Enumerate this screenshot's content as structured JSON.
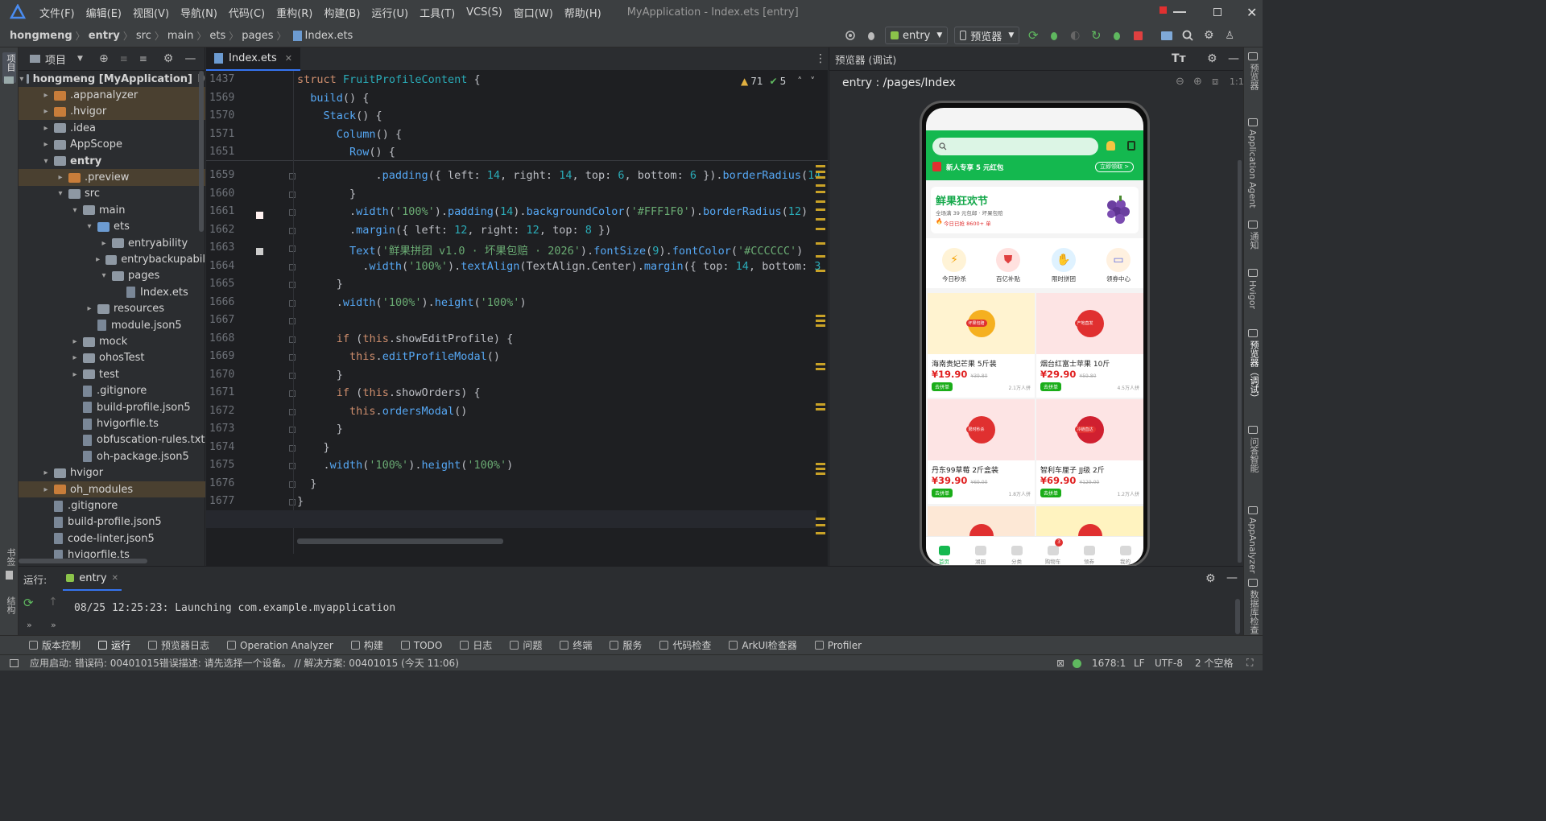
{
  "menu": {
    "items": [
      "文件(F)",
      "编辑(E)",
      "视图(V)",
      "导航(N)",
      "代码(C)",
      "重构(R)",
      "构建(B)",
      "运行(U)",
      "工具(T)",
      "VCS(S)",
      "窗口(W)",
      "帮助(H)"
    ],
    "window_title": "MyApplication - Index.ets [entry]"
  },
  "breadcrumb": {
    "items": [
      "hongmeng",
      "entry",
      "src",
      "main",
      "ets",
      "pages"
    ],
    "file": "Index.ets"
  },
  "toolbar": {
    "config": "entry",
    "previewer": "预览器"
  },
  "project": {
    "title": "项目",
    "rows": [
      {
        "label": "hongmeng [MyApplication]",
        "suffix": "D",
        "depth": 0,
        "type": "folder-g",
        "arrow": "▾",
        "bold": true
      },
      {
        "label": ".appanalyzer",
        "depth": 1,
        "type": "folder-o",
        "arrow": "▸",
        "hl": true
      },
      {
        "label": ".hvigor",
        "depth": 1,
        "type": "folder-o",
        "arrow": "▸",
        "hl": true
      },
      {
        "label": ".idea",
        "depth": 1,
        "type": "folder-g",
        "arrow": "▸"
      },
      {
        "label": "AppScope",
        "depth": 1,
        "type": "folder-g",
        "arrow": "▸"
      },
      {
        "label": "entry",
        "depth": 1,
        "type": "folder-g",
        "arrow": "▾",
        "bold": true
      },
      {
        "label": ".preview",
        "depth": 2,
        "type": "folder-o",
        "arrow": "▸",
        "hl": true
      },
      {
        "label": "src",
        "depth": 2,
        "type": "folder-g",
        "arrow": "▾"
      },
      {
        "label": "main",
        "depth": 3,
        "type": "folder-g",
        "arrow": "▾"
      },
      {
        "label": "ets",
        "depth": 4,
        "type": "folder-b",
        "arrow": "▾"
      },
      {
        "label": "entryability",
        "depth": 5,
        "type": "folder-g",
        "arrow": "▸"
      },
      {
        "label": "entrybackupabil",
        "depth": 5,
        "type": "folder-g",
        "arrow": "▸"
      },
      {
        "label": "pages",
        "depth": 5,
        "type": "folder-g",
        "arrow": "▾"
      },
      {
        "label": "Index.ets",
        "depth": 6,
        "type": "file",
        "arrow": ""
      },
      {
        "label": "resources",
        "depth": 4,
        "type": "folder-g",
        "arrow": "▸"
      },
      {
        "label": "module.json5",
        "depth": 4,
        "type": "file",
        "arrow": ""
      },
      {
        "label": "mock",
        "depth": 3,
        "type": "folder-g",
        "arrow": "▸"
      },
      {
        "label": "ohosTest",
        "depth": 3,
        "type": "folder-g",
        "arrow": "▸"
      },
      {
        "label": "test",
        "depth": 3,
        "type": "folder-g",
        "arrow": "▸"
      },
      {
        "label": ".gitignore",
        "depth": 3,
        "type": "file",
        "arrow": ""
      },
      {
        "label": "build-profile.json5",
        "depth": 3,
        "type": "file",
        "arrow": ""
      },
      {
        "label": "hvigorfile.ts",
        "depth": 3,
        "type": "file",
        "arrow": ""
      },
      {
        "label": "obfuscation-rules.txt",
        "depth": 3,
        "type": "file",
        "arrow": ""
      },
      {
        "label": "oh-package.json5",
        "depth": 3,
        "type": "file",
        "arrow": ""
      },
      {
        "label": "hvigor",
        "depth": 1,
        "type": "folder-g",
        "arrow": "▸"
      },
      {
        "label": "oh_modules",
        "depth": 1,
        "type": "folder-o",
        "arrow": "▸",
        "hl": true
      },
      {
        "label": ".gitignore",
        "depth": 1,
        "type": "file",
        "arrow": ""
      },
      {
        "label": "build-profile.json5",
        "depth": 1,
        "type": "file",
        "arrow": ""
      },
      {
        "label": "code-linter.json5",
        "depth": 1,
        "type": "file",
        "arrow": ""
      },
      {
        "label": "hvigorfile.ts",
        "depth": 1,
        "type": "file",
        "arrow": ""
      }
    ]
  },
  "editor": {
    "tab": "Index.ets",
    "warnings": "71",
    "ok": "5",
    "sticky": [
      {
        "n": "1437",
        "html": "<span class='kw'>struct</span> <span class='ty'>FruitProfileContent</span> {"
      },
      {
        "n": "1569",
        "html": "  <span class='fn'>build</span>() {"
      },
      {
        "n": "1570",
        "html": "    <span class='fn'>Stack</span>() {"
      },
      {
        "n": "1571",
        "html": "      <span class='fn'>Column</span>() {"
      },
      {
        "n": "1651",
        "html": "        <span class='fn'>Row</span>() {"
      }
    ],
    "lines": [
      {
        "n": "1659",
        "html": "            .<span class='fn'>padding</span>({ <span class='pm'>left</span>: <span class='nm'>14</span>, <span class='pm'>right</span>: <span class='nm'>14</span>, <span class='pm'>top</span>: <span class='nm'>6</span>, <span class='pm'>bottom</span>: <span class='nm'>6</span> }).<span class='fn'>borderRadius</span>(<span class='nm'>14</span>"
      },
      {
        "n": "1660",
        "html": "        }"
      },
      {
        "n": "1661",
        "html": "        .<span class='fn'>width</span>(<span class='st'>'100%'</span>).<span class='fn'>padding</span>(<span class='nm'>14</span>).<span class='fn'>backgroundColor</span>(<span class='st'>'#FFF1F0'</span>).<span class='fn'>borderRadius</span>(<span class='nm'>12</span>)"
      },
      {
        "n": "1662",
        "html": "        .<span class='fn'>margin</span>({ <span class='pm'>left</span>: <span class='nm'>12</span>, <span class='pm'>right</span>: <span class='nm'>12</span>, <span class='pm'>top</span>: <span class='nm'>8</span> })"
      },
      {
        "n": "1663",
        "html": "        <span class='fn'>Text</span>(<span class='st'>'鲜果拼团 v1.0 · 坏果包赔 · 2026'</span>).<span class='fn'>fontSize</span>(<span class='nm'>9</span>).<span class='fn'>fontColor</span>(<span class='st'>'#CCCCCC'</span>)"
      },
      {
        "n": "1664",
        "html": "          .<span class='fn'>width</span>(<span class='st'>'100%'</span>).<span class='fn'>textAlign</span>(TextAlign.Center).<span class='fn'>margin</span>({ <span class='pm'>top</span>: <span class='nm'>14</span>, <span class='pm'>bottom</span>: <span class='nm'>3</span>"
      },
      {
        "n": "1665",
        "html": "      }"
      },
      {
        "n": "1666",
        "html": "      .<span class='fn'>width</span>(<span class='st'>'100%'</span>).<span class='fn'>height</span>(<span class='st'>'100%'</span>)"
      },
      {
        "n": "1667",
        "html": ""
      },
      {
        "n": "1668",
        "html": "      <span class='kw'>if</span> (<span class='kw'>this</span>.showEditProfile) {"
      },
      {
        "n": "1669",
        "html": "        <span class='kw'>this</span>.<span class='fn'>editProfileModal</span>()"
      },
      {
        "n": "1670",
        "html": "      }"
      },
      {
        "n": "1671",
        "html": "      <span class='kw'>if</span> (<span class='kw'>this</span>.showOrders) {"
      },
      {
        "n": "1672",
        "html": "        <span class='kw'>this</span>.<span class='fn'>ordersModal</span>()"
      },
      {
        "n": "1673",
        "html": "      }"
      },
      {
        "n": "1674",
        "html": "    }"
      },
      {
        "n": "1675",
        "html": "    .<span class='fn'>width</span>(<span class='st'>'100%'</span>).<span class='fn'>height</span>(<span class='st'>'100%'</span>)"
      },
      {
        "n": "1676",
        "html": "  }"
      },
      {
        "n": "1677",
        "html": "}"
      },
      {
        "n": "1678",
        "html": ""
      }
    ]
  },
  "preview": {
    "title": "预览器 (调试)",
    "path": "entry : /pages/Index"
  },
  "app": {
    "banner_text": "新人专享 5 元红包",
    "banner_btn": "立即领取 >",
    "promo_title": "鲜果狂欢节",
    "promo_sub": "全场满 39 元包邮 · 坏果包赔",
    "promo_sold": "今日已抢 8600+ 单",
    "cats": [
      "今日秒杀",
      "百亿补贴",
      "限时拼团",
      "领券中心"
    ],
    "products": [
      {
        "name": "海南贵妃芒果 5斤装",
        "price": "¥19.90",
        "old": "¥39.80",
        "tag": "去拼单",
        "sold": "2.1万人拼",
        "badge": "坏果包赔"
      },
      {
        "name": "烟台红富士苹果 10斤",
        "price": "¥29.90",
        "old": "¥59.80",
        "tag": "去拼单",
        "sold": "4.5万人拼",
        "badge": "产地直发"
      },
      {
        "name": "丹东99草莓 2斤盒装",
        "price": "¥39.90",
        "old": "¥69.00",
        "tag": "去拼单",
        "sold": "1.8万人拼",
        "badge": "限时秒杀"
      },
      {
        "name": "智利车厘子 JJ级 2斤",
        "price": "¥69.90",
        "old": "¥129.00",
        "tag": "去拼单",
        "sold": "1.2万人拼",
        "badge": "冷链直达"
      }
    ],
    "nav": [
      "首页",
      "湖园",
      "分类",
      "购物车",
      "领券",
      "我的"
    ],
    "cart_count": "3"
  },
  "run": {
    "label": "运行:",
    "tab": "entry",
    "log": "08/25 12:25:23: Launching com.example.myapplication"
  },
  "bottom_tools": [
    "版本控制",
    "运行",
    "预览器日志",
    "Operation Analyzer",
    "构建",
    "TODO",
    "日志",
    "问题",
    "终端",
    "服务",
    "代码检查",
    "ArkUI检查器",
    "Profiler"
  ],
  "status": {
    "message": "应用启动: 错误码: 00401015错误描述: 请先选择一个设备。 // 解决方案: 00401015 (今天 11:06)",
    "position": "1678:1",
    "lf": "LF",
    "encoding": "UTF-8",
    "indent": "2 个空格"
  },
  "right_strip": [
    "预览器",
    "Application Agent",
    "通知",
    "Hvigor",
    "预览器（调试）",
    "问答智能",
    "AppAnalyzer",
    "数据库检查"
  ],
  "left_strip": [
    "项目",
    "书签",
    "结构"
  ]
}
